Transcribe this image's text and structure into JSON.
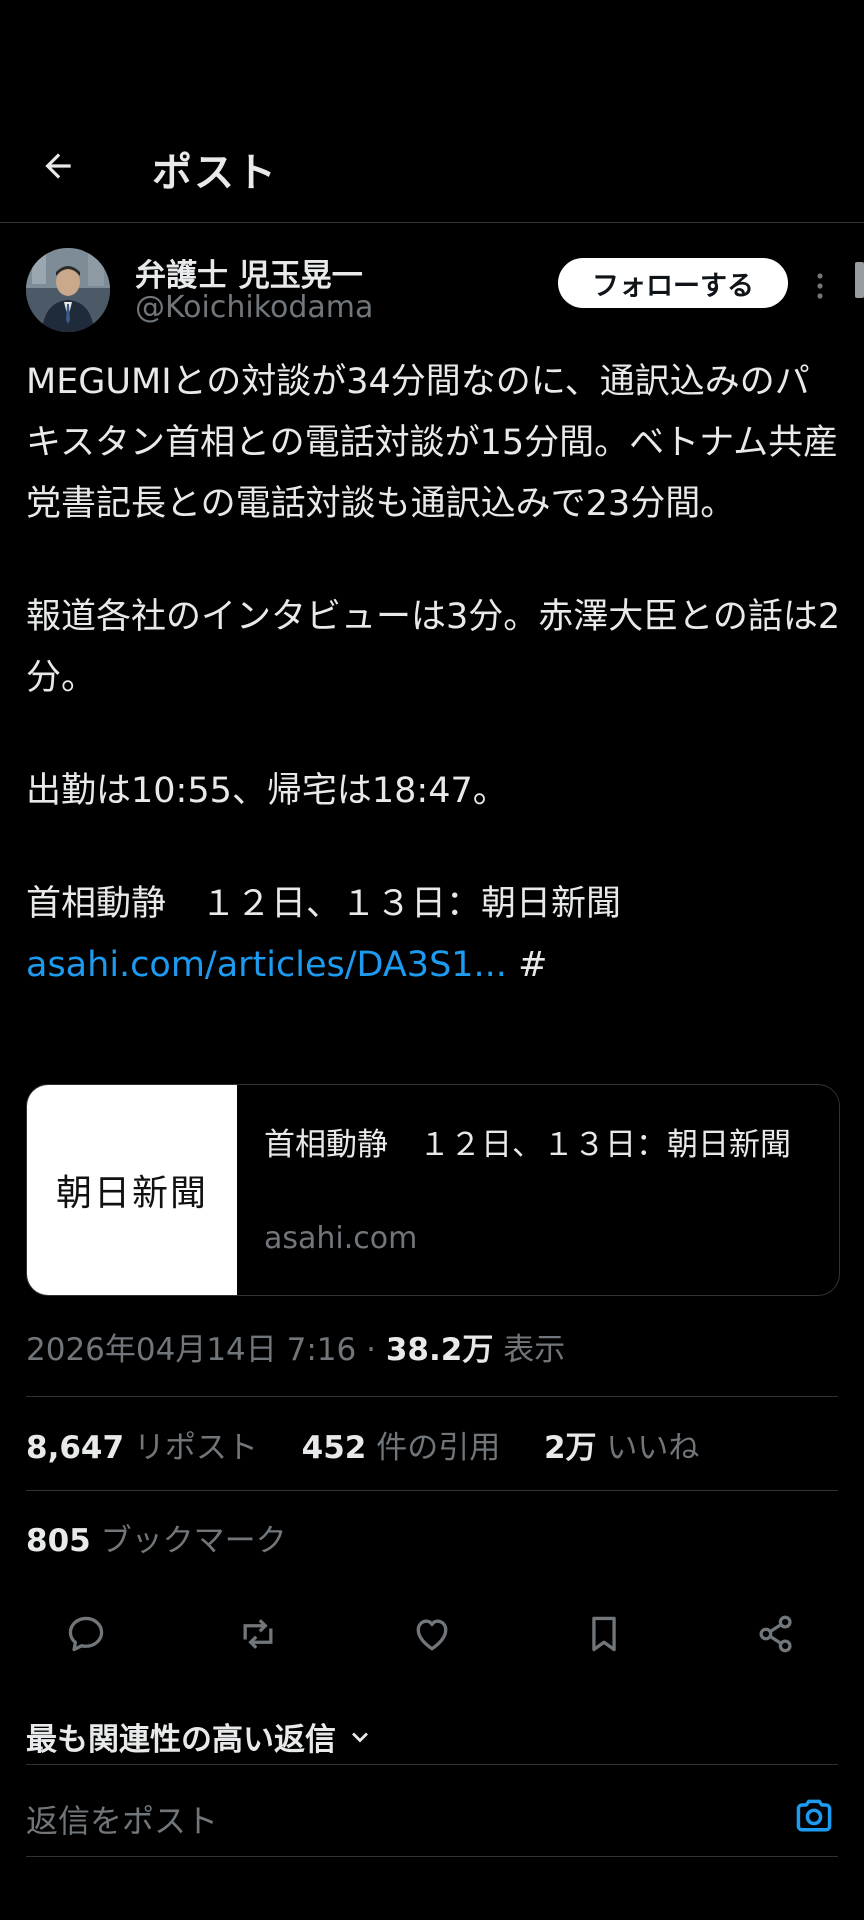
{
  "header": {
    "title": "ポスト",
    "back_icon": "arrow-left-icon"
  },
  "author": {
    "name": "弁護士 児玉晃一",
    "handle": "@Koichikodama",
    "follow_label": "フォローする"
  },
  "tweet": {
    "paragraphs": [
      "MEGUMIとの対談が34分間なのに、通訳込みのパキスタン首相との電話対談が15分間。ベトナム共産党書記長との電話対談も通訳込みで23分間。",
      "報道各社のインタビューは3分。赤澤大臣との話は2分。",
      "出勤は10:55、帰宅は18:47。",
      "首相動静　１２日、１３日：朝日新聞"
    ],
    "link": "asahi.com/articles/DA3S1...",
    "hash": "#"
  },
  "card": {
    "thumb_text": "朝日新聞",
    "title": "首相動静　１２日、１３日：朝日新聞",
    "domain": "asahi.com"
  },
  "meta": {
    "datetime": "2026年04月14日 7:16",
    "separator": "·",
    "views": "38.2万",
    "views_label": "表示"
  },
  "stats": {
    "reposts": "8,647",
    "reposts_label": "リポスト",
    "quotes": "452",
    "quotes_label": "件の引用",
    "likes": "2万",
    "likes_label": "いいね",
    "bookmarks": "805",
    "bookmarks_label": "ブックマーク"
  },
  "actions": [
    "reply-icon",
    "repost-icon",
    "like-icon",
    "bookmark-icon",
    "share-icon"
  ],
  "replies": {
    "sort_label": "最も関連性の高い返信",
    "placeholder": "返信をポスト"
  },
  "colors": {
    "background": "#000000",
    "text": "#e7e9ea",
    "muted": "#71767b",
    "link": "#1d9bf0",
    "divider": "#2f3336"
  }
}
